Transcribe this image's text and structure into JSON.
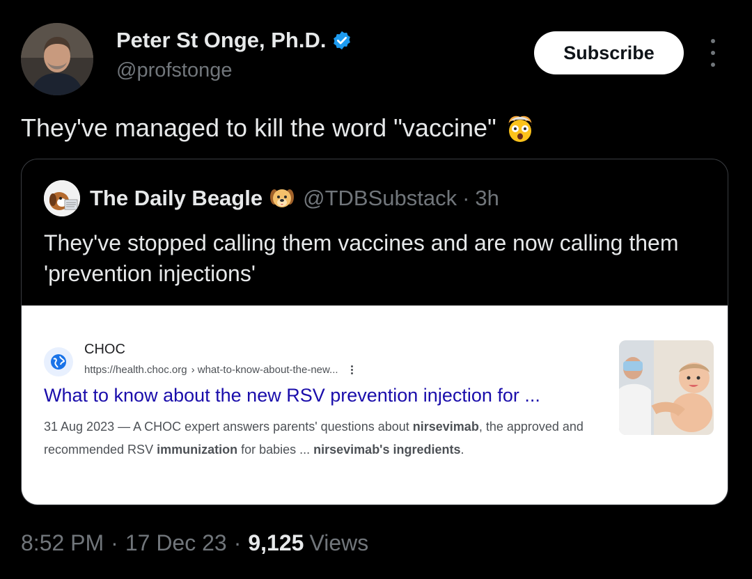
{
  "author": {
    "name": "Peter St Onge, Ph.D.",
    "handle": "@profstonge"
  },
  "subscribe_label": "Subscribe",
  "tweet": {
    "text": "They've managed to kill the word \"vaccine\""
  },
  "quoted": {
    "name": "The Daily Beagle",
    "handle": "@TDBSubstack",
    "separator": "·",
    "time": "3h",
    "text": "They've stopped calling them vaccines and are now calling them 'prevention injections'"
  },
  "search_result": {
    "site_name": "CHOC",
    "url_domain": "https://health.choc.org",
    "url_path": "› what-to-know-about-the-new...",
    "title": "What to know about the new RSV prevention injection for ...",
    "snippet_parts": [
      {
        "text": "31 Aug 2023 — A CHOC expert answers parents' questions about ",
        "bold": false
      },
      {
        "text": "nirsevimab",
        "bold": true
      },
      {
        "text": ", the approved and recommended RSV ",
        "bold": false
      },
      {
        "text": "immunization",
        "bold": true
      },
      {
        "text": " for babies ... ",
        "bold": false
      },
      {
        "text": "nirsevimab's ingredients",
        "bold": true
      },
      {
        "text": ".",
        "bold": false
      }
    ]
  },
  "meta": {
    "time": "8:52 PM",
    "date": "17 Dec 23",
    "separator": "·",
    "views_count": "9,125",
    "views_label": "Views"
  },
  "icons": {
    "verified": "verified-badge-icon",
    "more": "more-options-icon",
    "face_emoji": "exploding-head-emoji",
    "dog_emoji": "dog-face-emoji",
    "globe": "globe-icon"
  },
  "colors": {
    "background": "#000000",
    "text_primary": "#e7e9ea",
    "text_secondary": "#71767b",
    "verified_blue": "#1d9bf0",
    "link_blue": "#1a0dab"
  }
}
